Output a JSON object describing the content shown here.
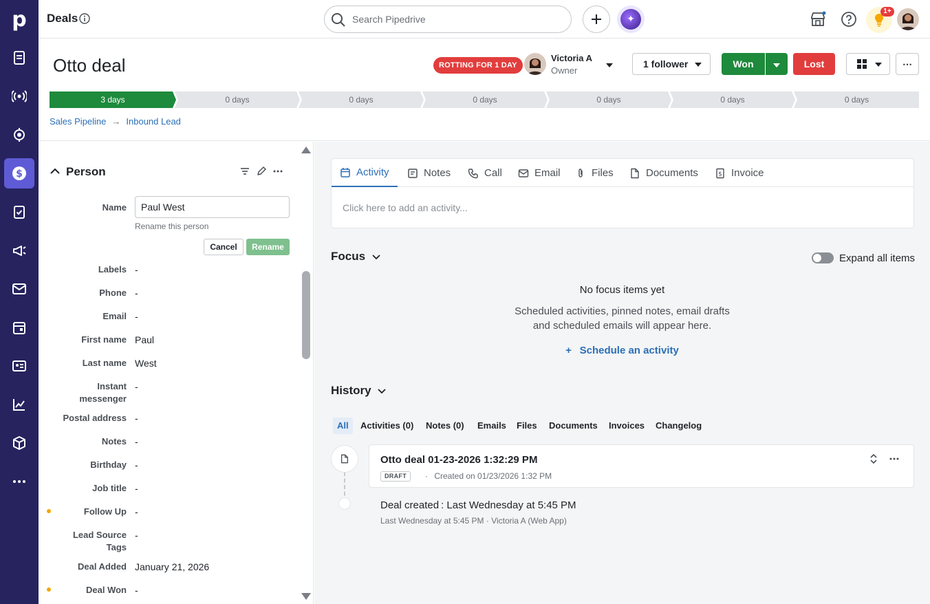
{
  "nav": {
    "logo": "p",
    "items": [
      {
        "icon": "leads-icon"
      },
      {
        "icon": "broadcast-icon"
      },
      {
        "icon": "target-icon"
      },
      {
        "icon": "deals-dollar-icon",
        "active": true
      },
      {
        "icon": "tasks-icon"
      },
      {
        "icon": "campaigns-icon"
      },
      {
        "icon": "mail-icon"
      },
      {
        "icon": "calendar-icon"
      },
      {
        "icon": "contacts-icon"
      },
      {
        "icon": "insights-icon"
      },
      {
        "icon": "products-icon"
      },
      {
        "icon": "more-icon"
      }
    ],
    "bg_color": "#26235f",
    "active_color": "#5f5bd6"
  },
  "topbar": {
    "title": "Deals",
    "search_placeholder": "Search Pipedrive",
    "notification_badge": "1+"
  },
  "deal": {
    "title": "Otto deal",
    "rotting_badge": "ROTTING FOR 1 DAY",
    "owner_name": "Victoria A",
    "owner_role": "Owner",
    "followers_label": "1 follower",
    "won_label": "Won",
    "lost_label": "Lost",
    "more_label": "⋯",
    "stages": [
      {
        "label": "3 days",
        "active": true
      },
      {
        "label": "0 days",
        "active": false
      },
      {
        "label": "0 days",
        "active": false
      },
      {
        "label": "0 days",
        "active": false
      },
      {
        "label": "0 days",
        "active": false
      },
      {
        "label": "0 days",
        "active": false
      },
      {
        "label": "0 days",
        "active": false
      }
    ],
    "pipeline": "Sales Pipeline",
    "arrow": "→",
    "stage_name": "Inbound Lead",
    "colors": {
      "won": "#1e8a3c",
      "lost": "#e23d3d",
      "stage_active": "#1e8a3c",
      "stage_inactive": "#e3e5e8"
    }
  },
  "person": {
    "section_title": "Person",
    "name_label": "Name",
    "name_value": "Paul West",
    "rename_hint": "Rename this person",
    "cancel_label": "Cancel",
    "rename_label": "Rename",
    "fields": [
      {
        "label": "Labels",
        "value": "-",
        "dot": false
      },
      {
        "label": "Phone",
        "value": "-",
        "dot": false
      },
      {
        "label": "Email",
        "value": "-",
        "dot": false
      },
      {
        "label": "First name",
        "value": "Paul",
        "dot": false
      },
      {
        "label": "Last name",
        "value": "West",
        "dot": false
      },
      {
        "label": "Instant messenger",
        "value": "-",
        "dot": false
      },
      {
        "label": "Postal address",
        "value": "-",
        "dot": false
      },
      {
        "label": "Notes",
        "value": "-",
        "dot": false
      },
      {
        "label": "Birthday",
        "value": "-",
        "dot": false
      },
      {
        "label": "Job title",
        "value": "-",
        "dot": false
      },
      {
        "label": "Follow Up",
        "value": "-",
        "dot": true
      },
      {
        "label": "Lead Source Tags",
        "value": "-",
        "dot": false
      },
      {
        "label": "Deal Added",
        "value": "January 21, 2026",
        "dot": false
      },
      {
        "label": "Deal Won",
        "value": "-",
        "dot": true
      }
    ]
  },
  "composer": {
    "tabs": [
      {
        "label": "Activity",
        "icon": "calendar-icon",
        "active": true
      },
      {
        "label": "Notes",
        "icon": "note-icon",
        "active": false
      },
      {
        "label": "Call",
        "icon": "phone-icon",
        "active": false
      },
      {
        "label": "Email",
        "icon": "mail-icon",
        "active": false
      },
      {
        "label": "Files",
        "icon": "paperclip-icon",
        "active": false
      },
      {
        "label": "Documents",
        "icon": "document-icon",
        "active": false
      },
      {
        "label": "Invoice",
        "icon": "invoice-icon",
        "active": false
      }
    ],
    "placeholder": "Click here to add an activity..."
  },
  "focus": {
    "title": "Focus",
    "expand_label": "Expand all items",
    "empty_title": "No focus items yet",
    "empty_line1": "Scheduled activities, pinned notes, email drafts",
    "empty_line2": "and scheduled emails will appear here.",
    "schedule_link": "+  Schedule an activity"
  },
  "history": {
    "title": "History",
    "filters": [
      {
        "label": "All",
        "active": true
      },
      {
        "label": "Activities (0)",
        "active": false
      },
      {
        "label": "Notes (0)",
        "active": false
      },
      {
        "label": "Emails",
        "active": false
      },
      {
        "label": "Files",
        "active": false
      },
      {
        "label": "Documents",
        "active": false
      },
      {
        "label": "Invoices",
        "active": false
      },
      {
        "label": "Changelog",
        "active": false
      }
    ],
    "card_title": "Otto deal 01-23-2026 1:32:29 PM",
    "card_badge": "DRAFT",
    "card_meta": "·  Created on 01/23/2026 1:32 PM",
    "created_title": "Deal created : Last Wednesday at 5:45 PM",
    "created_meta": "Last Wednesday at 5:45 PM · Victoria A (Web App)"
  }
}
